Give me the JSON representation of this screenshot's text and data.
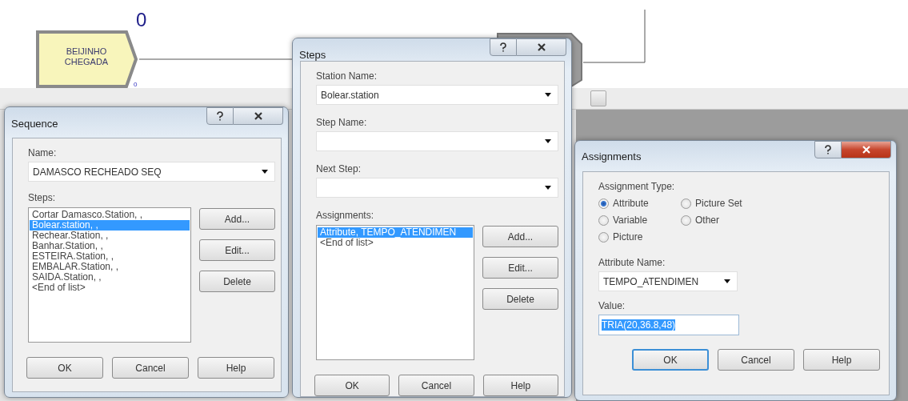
{
  "canvas": {
    "top_counter": "0",
    "module": {
      "label_lines": [
        "BEIJINHO",
        "CHEGADA"
      ],
      "counter": "0"
    }
  },
  "sequence_dialog": {
    "title": "Sequence",
    "active": false,
    "name_label": "Name:",
    "name_value": "DAMASCO RECHEADO SEQ",
    "steps_label": "Steps:",
    "steps": [
      {
        "text": "Cortar Damasco.Station, ,",
        "selected": false
      },
      {
        "text": "Bolear.station, ,",
        "selected": true
      },
      {
        "text": "Rechear.Station, ,",
        "selected": false
      },
      {
        "text": "Banhar.Station, ,",
        "selected": false
      },
      {
        "text": "ESTEIRA.Station, ,",
        "selected": false
      },
      {
        "text": "EMBALAR.Station, ,",
        "selected": false
      },
      {
        "text": "SAIDA.Station, ,",
        "selected": false
      },
      {
        "text": "<End of list>",
        "selected": false
      }
    ],
    "side_buttons": [
      "Add...",
      "Edit...",
      "Delete"
    ],
    "buttons": [
      {
        "label": "OK",
        "default": false
      },
      {
        "label": "Cancel",
        "default": false
      },
      {
        "label": "Help",
        "default": false
      }
    ]
  },
  "steps_dialog": {
    "title": "Steps",
    "active": false,
    "fields": [
      {
        "label": "Station Name:",
        "value": "Bolear.station"
      },
      {
        "label": "Step Name:"
      },
      {
        "label": "Next Step:"
      }
    ],
    "assignments_label": "Assignments:",
    "assignments": [
      {
        "text": "Attribute, TEMPO_ATENDIMEN",
        "selected": true
      },
      {
        "text": "<End of list>",
        "selected": false
      }
    ],
    "side_buttons": [
      "Add...",
      "Edit...",
      "Delete"
    ],
    "buttons": [
      {
        "label": "OK",
        "default": false
      },
      {
        "label": "Cancel",
        "default": false
      },
      {
        "label": "Help",
        "default": false
      }
    ]
  },
  "assignments_dialog": {
    "title": "Assignments",
    "active": true,
    "type_label": "Assignment Type:",
    "types": [
      {
        "label": "Attribute",
        "selected": true
      },
      {
        "label": "Picture Set",
        "selected": false
      },
      {
        "label": "Variable",
        "selected": false
      },
      {
        "label": "Other",
        "selected": false
      },
      {
        "label": "Picture",
        "selected": false
      }
    ],
    "attribute_label": "Attribute Name:",
    "attribute_value": "TEMPO_ATENDIMEN",
    "value_label": "Value:",
    "value": "TRIA(20,36.8,48)",
    "value_selected": true,
    "buttons": [
      {
        "label": "OK",
        "default": true
      },
      {
        "label": "Cancel",
        "default": false
      },
      {
        "label": "Help",
        "default": false
      }
    ]
  }
}
